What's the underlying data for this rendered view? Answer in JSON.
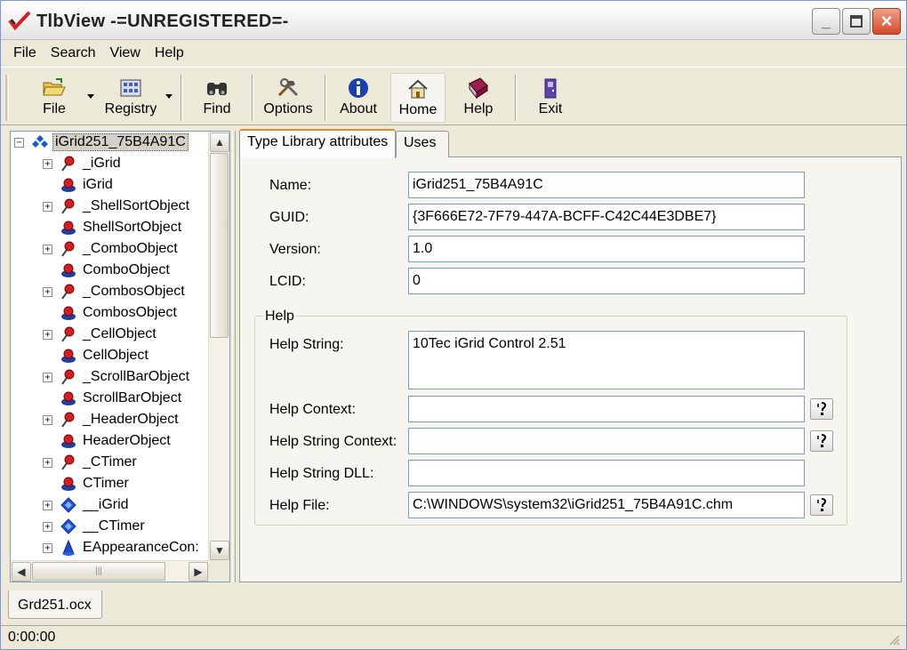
{
  "window": {
    "title": "TlbView -=UNREGISTERED=-"
  },
  "menu": [
    "File",
    "Search",
    "View",
    "Help"
  ],
  "toolbar": {
    "file": "File",
    "registry": "Registry",
    "find": "Find",
    "options": "Options",
    "about": "About",
    "home": "Home",
    "help": "Help",
    "exit": "Exit"
  },
  "tree": {
    "root": "iGrid251_75B4A91C",
    "items": [
      "_iGrid",
      "iGrid",
      "_ShellSortObject",
      "ShellSortObject",
      "_ComboObject",
      "ComboObject",
      "_CombosObject",
      "CombosObject",
      "_CellObject",
      "CellObject",
      "_ScrollBarObject",
      "ScrollBarObject",
      "_HeaderObject",
      "HeaderObject",
      "_CTimer",
      "CTimer",
      "__iGrid",
      "__CTimer",
      "EAppearanceCon:"
    ]
  },
  "tabs": {
    "attributes": "Type Library attributes",
    "uses": "Uses"
  },
  "attributes": {
    "name_label": "Name:",
    "name_value": "iGrid251_75B4A91C",
    "guid_label": "GUID:",
    "guid_value": "{3F666E72-7F79-447A-BCFF-C42C44E3DBE7}",
    "version_label": "Version:",
    "version_value": "1.0",
    "lcid_label": "LCID:",
    "lcid_value": "0"
  },
  "help_group": {
    "title": "Help",
    "string_label": "Help String:",
    "string_value": "10Tec iGrid Control 2.51",
    "context_label": "Help Context:",
    "context_value": "",
    "string_context_label": "Help String Context:",
    "string_context_value": "",
    "string_dll_label": "Help String DLL:",
    "string_dll_value": "",
    "file_label": "Help File:",
    "file_value": "C:\\WINDOWS\\system32\\iGrid251_75B4A91C.chm"
  },
  "document_tab": "Grd251.ocx",
  "status": {
    "time": "0:00:00"
  }
}
